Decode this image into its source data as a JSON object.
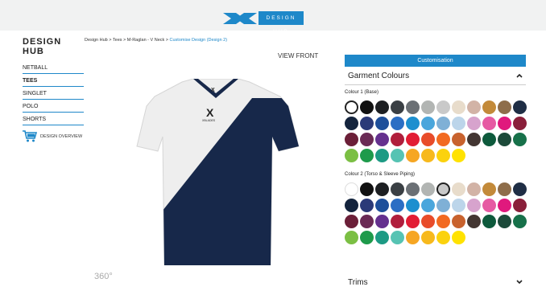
{
  "header": {
    "logo_text": "DESIGN HUB"
  },
  "sidebar": {
    "title": "DESIGN HUB",
    "items": [
      {
        "label": "NETBALL",
        "active": false
      },
      {
        "label": "TEES",
        "active": true
      },
      {
        "label": "SINGLET",
        "active": false
      },
      {
        "label": "POLO",
        "active": false
      },
      {
        "label": "SHORTS",
        "active": false
      }
    ],
    "overview_label": "DESIGN OVERVIEW"
  },
  "breadcrumb": {
    "path": "Design Hub > Tees > M-Raglan - V Neck > ",
    "current": "Customise Design (Design 2)"
  },
  "viewer": {
    "view_label": "VIEW FRONT",
    "rotate_label": "360°",
    "shirt_brand": "XBLADES",
    "colors": {
      "base": "#eeeeee",
      "torso": "#17284a"
    }
  },
  "panel": {
    "customisation_label": "Customisation",
    "garment_colours_label": "Garment Colours",
    "colour1_label": "Colour 1 (Base)",
    "colour2_label": "Colour 2 (Torso & Sleeve Piping)",
    "trims_label": "Trims",
    "colour1_selected_index": 0,
    "colour2_selected_index": 6,
    "swatches": [
      "#ffffff",
      "#111111",
      "#1d1f22",
      "#3a3f44",
      "#6b7075",
      "#b2b5b3",
      "#c9c9c9",
      "#e8dccb",
      "#d2b3a6",
      "#c38a3a",
      "#8e6d4a",
      "#ffffff",
      "#1f2e45",
      "#14243d",
      "#2b3a78",
      "#1e4f9a",
      "#2b6ec4",
      "#1d8fcf",
      "#4aa6dc",
      "#7fb0d6",
      "#bcd5ea",
      "#d7a3cd",
      "#e65aa3",
      "#ffffff",
      "#e0197d",
      "#8a1f3a",
      "#6b1f38",
      "#6a2a55",
      "#64308e",
      "#b01e3c",
      "#e21d34",
      "#e84c2a",
      "#f26a21",
      "#c8622e",
      "#433632",
      "#ffffff",
      "#0e5a3c",
      "#1c4a3a",
      "#17714a",
      "#7bbf44",
      "#1e9a4b",
      "#1d9a84",
      "#56c3b3",
      "#f6a623",
      "#f7b91d",
      "#fbd20e",
      "#ffe200",
      "#ffffff"
    ]
  }
}
